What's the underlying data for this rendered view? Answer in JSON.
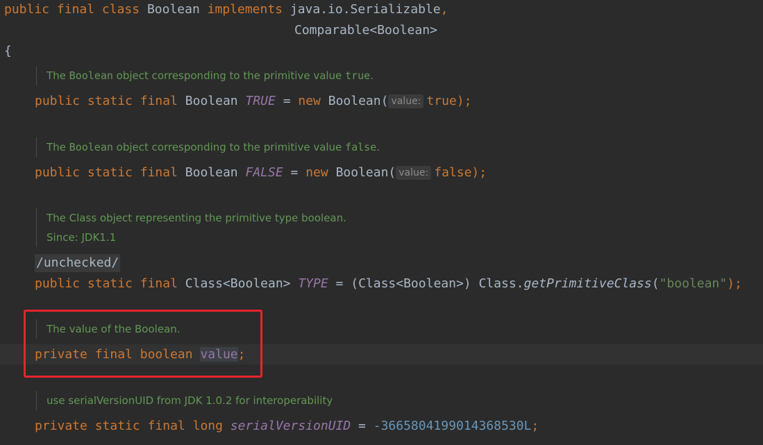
{
  "code": {
    "l1": {
      "public": "public",
      "final": "final",
      "class": "class",
      "name": "Boolean",
      "implements": "implements",
      "iface1": "java.io.Serializable",
      "comma": ","
    },
    "l2": {
      "iface2": "Comparable<Boolean>"
    },
    "l3": {
      "brace": "{"
    },
    "doc1": {
      "pre": "The ",
      "code": "Boolean",
      "mid": " object corresponding to the primitive value ",
      "code2": "true",
      "post": "."
    },
    "decl1": {
      "public": "public",
      "static": "static",
      "final": "final",
      "type": "Boolean",
      "name": "TRUE",
      "eq": "=",
      "new": "new",
      "ctor": "Boolean(",
      "hint": "value:",
      "arg": "true",
      "close": ");"
    },
    "doc2": {
      "pre": "The ",
      "code": "Boolean",
      "mid": " object corresponding to the primitive value ",
      "code2": "false",
      "post": "."
    },
    "decl2": {
      "public": "public",
      "static": "static",
      "final": "final",
      "type": "Boolean",
      "name": "FALSE",
      "eq": "=",
      "new": "new",
      "ctor": "Boolean(",
      "hint": "value:",
      "arg": "false",
      "close": ");"
    },
    "doc3": {
      "line1": "The Class object representing the primitive type boolean.",
      "line2": "Since: JDK1.1"
    },
    "anno": "/unchecked/",
    "decl3": {
      "public": "public",
      "static": "static",
      "final": "final",
      "type": "Class<Boolean>",
      "name": "TYPE",
      "eq": "=",
      "cast": "(Class<Boolean>)",
      "recv": "Class.",
      "method": "getPrimitiveClass",
      "open": "(",
      "str": "\"boolean\"",
      "close": ");"
    },
    "doc4": {
      "text": "The value of the Boolean."
    },
    "decl4": {
      "private": "private",
      "final": "final",
      "type": "boolean",
      "name": "value",
      "semi": ";"
    },
    "doc5": {
      "text": "use serialVersionUID from JDK 1.0.2 for interoperability"
    },
    "decl5": {
      "private": "private",
      "static": "static",
      "final": "final",
      "type": "long",
      "name": "serialVersionUID",
      "eq": "=",
      "num": "-3665804199014368530L",
      "semi": ";"
    }
  },
  "colors": {
    "background": "#2b2b2b",
    "keyword": "#cc7832",
    "field": "#9876aa",
    "doc_comment": "#629755",
    "string": "#6a8759",
    "number": "#6897bb",
    "highlight_box": "#e8232e"
  }
}
